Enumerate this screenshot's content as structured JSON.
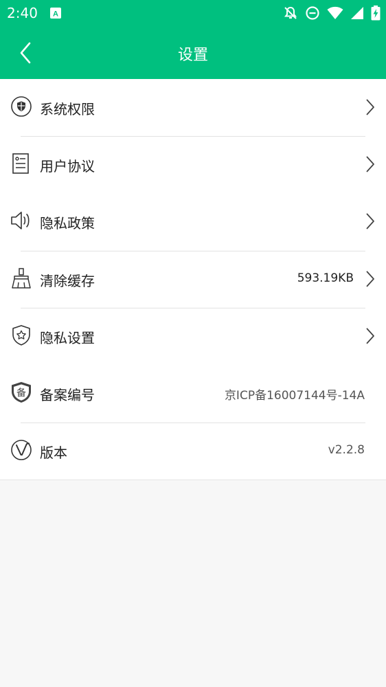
{
  "status_bar": {
    "time": "2:40",
    "app_icon": "A"
  },
  "header": {
    "title": "设置"
  },
  "items": [
    {
      "label": "系统权限",
      "icon": "shield-circle-icon"
    },
    {
      "label": "用户协议",
      "icon": "document-icon"
    },
    {
      "label": "隐私政策",
      "icon": "speaker-icon"
    },
    {
      "label": "清除缓存",
      "icon": "broom-icon",
      "value": "593.19KB"
    },
    {
      "label": "隐私设置",
      "icon": "shield-star-icon"
    },
    {
      "label": "备案编号",
      "icon": "record-shield-icon",
      "value": "京ICP备16007144号-14A",
      "badge": "备"
    },
    {
      "label": "版本",
      "icon": "version-v-icon",
      "value": "v2.2.8"
    }
  ],
  "colors": {
    "brand": "#00c07f",
    "background": "#f7f7f7"
  }
}
